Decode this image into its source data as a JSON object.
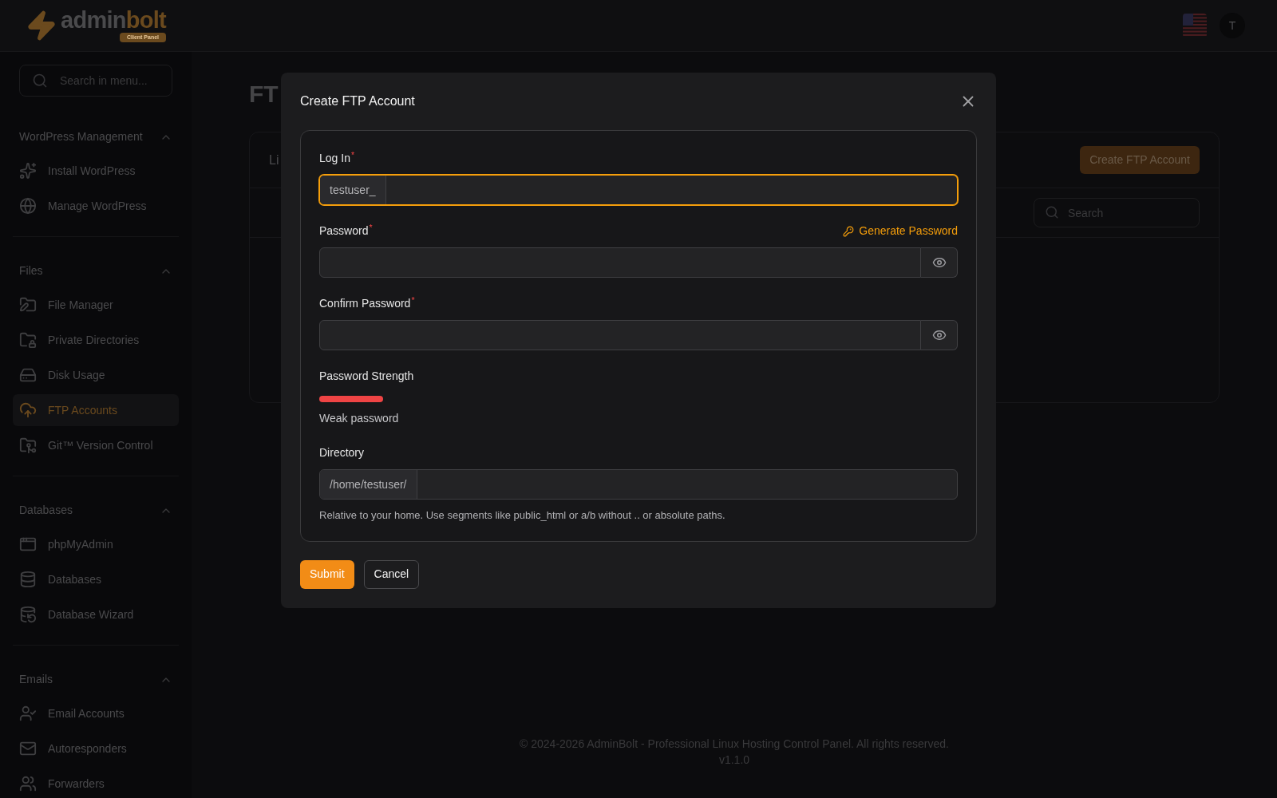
{
  "header": {
    "logo": {
      "part_1": "admin",
      "part_2": "bolt",
      "badge": "Client Panel"
    },
    "avatar": "T"
  },
  "sidebar": {
    "search": {
      "placeholder": "Search in menu..."
    },
    "sections": [
      {
        "title": "WordPress Management",
        "expanded": true,
        "items": [
          {
            "label": "Install WordPress",
            "selected": false
          },
          {
            "label": "Manage WordPress",
            "selected": false
          }
        ]
      },
      {
        "title": "Files",
        "expanded": true,
        "items": [
          {
            "label": "File Manager",
            "selected": false
          },
          {
            "label": "Private Directories",
            "selected": false
          },
          {
            "label": "Disk Usage",
            "selected": false
          },
          {
            "label": "FTP Accounts",
            "selected": true
          },
          {
            "label": "Git™ Version Control",
            "selected": false
          }
        ]
      },
      {
        "title": "Databases",
        "expanded": true,
        "items": [
          {
            "label": "phpMyAdmin",
            "selected": false
          },
          {
            "label": "Databases",
            "selected": false
          },
          {
            "label": "Database Wizard",
            "selected": false
          }
        ]
      },
      {
        "title": "Emails",
        "expanded": true,
        "items": [
          {
            "label": "Email Accounts",
            "selected": false
          },
          {
            "label": "Autoresponders",
            "selected": false
          },
          {
            "label": "Forwarders",
            "selected": false
          }
        ]
      }
    ]
  },
  "main": {
    "title": "FT",
    "card": {
      "tab_label": "Li",
      "create_button": "Create FTP Account",
      "search": {
        "placeholder": "Search"
      }
    }
  },
  "footer": {
    "copyright": "© 2024-2026 AdminBolt - Professional Linux Hosting Control Panel. All rights reserved.",
    "version": "v1.1.0"
  },
  "modal": {
    "title": "Create FTP Account",
    "fields": [
      {
        "kind": "prefixed",
        "label": "Log In",
        "required_mark": "*",
        "prefix": "testuser_",
        "focused": true
      },
      {
        "kind": "password",
        "label": "Password",
        "required_mark": "*",
        "action": "Generate Password"
      },
      {
        "kind": "password",
        "label": "Confirm Password",
        "required_mark": "*"
      },
      {
        "kind": "strength",
        "label": "Password Strength",
        "level": 0.1,
        "reading": "Weak password"
      },
      {
        "kind": "prefixed",
        "label": "Directory",
        "prefix": "/home/testuser/",
        "focused": false,
        "help": "Relative to your home. Use segments like public_html or a/b without .. or absolute paths."
      }
    ],
    "buttons": {
      "submit": "Submit",
      "cancel": "Cancel"
    }
  }
}
